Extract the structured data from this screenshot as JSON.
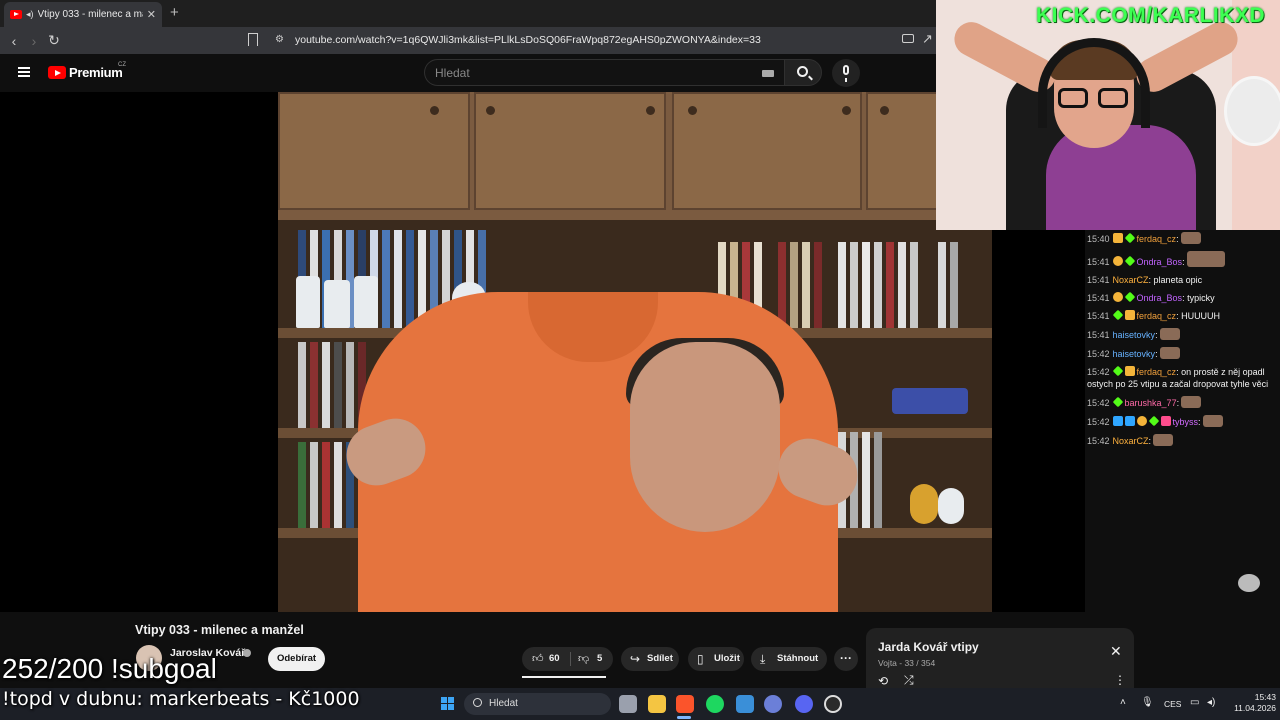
{
  "browser": {
    "tab_title": "Vtipy 033 - milenec a manžel",
    "tab_close": "✕",
    "new_tab": "+",
    "url": "youtube.com/watch?v=1q6QWJli3mk&list=PLlkLsDoSQ06FraWpq872egAHS0pZWONYA&index=33"
  },
  "youtube": {
    "logo_text": "Premium",
    "region": "CZ",
    "search_placeholder": "Hledat"
  },
  "stream": {
    "kick_url": "KICK.COM/KARLIKXD",
    "subgoal": "252/200 !subgoal",
    "top_donation": "!topd v dubnu: markerbeats - Kč1000"
  },
  "chat": [
    {
      "time": "15:40",
      "user": "ferdaq_cz",
      "user_color": "#f0a03c",
      "badges": [
        "sub",
        "star"
      ],
      "text": ":",
      "emote": true
    },
    {
      "time": "15:41",
      "user": "Ondra_Bos",
      "user_color": "#c264ff",
      "badges": [
        "coin",
        "star"
      ],
      "text": ":",
      "emote": true,
      "big": true
    },
    {
      "time": "15:41",
      "user": "NoxarCZ",
      "user_color": "#ffb23e",
      "badges": [],
      "text": ": planeta opic",
      "emote": false
    },
    {
      "time": "15:41",
      "user": "Ondra_Bos",
      "user_color": "#c264ff",
      "badges": [
        "coin",
        "star"
      ],
      "text": ": typicky",
      "emote": false
    },
    {
      "time": "15:41",
      "user": "ferdaq_cz",
      "user_color": "#f0a03c",
      "badges": [
        "star",
        "sub"
      ],
      "text": ": HUUUUH",
      "emote": false
    },
    {
      "time": "15:41",
      "user": "haisetovky",
      "user_color": "#67b2ff",
      "badges": [],
      "text": ":",
      "emote": true
    },
    {
      "time": "15:42",
      "user": "haisetovky",
      "user_color": "#67b2ff",
      "badges": [],
      "text": ":",
      "emote": true
    },
    {
      "time": "15:42",
      "user": "ferdaq_cz",
      "user_color": "#f0a03c",
      "badges": [
        "star",
        "sub"
      ],
      "text": ": on prostě z něj opadl ostych po 25 vtipu a začal dropovat tyhle věci",
      "emote": false
    },
    {
      "time": "15:42",
      "user": "barushka_77",
      "user_color": "#ff6aa8",
      "badges": [
        "star"
      ],
      "text": ":",
      "emote": true
    },
    {
      "time": "15:42",
      "user": "tybyss",
      "user_color": "#d36bff",
      "badges": [
        "blue",
        "blue",
        "coin",
        "star",
        "pink"
      ],
      "text": ":",
      "emote": true
    },
    {
      "time": "15:42",
      "user": "NoxarCZ",
      "user_color": "#ffb23e",
      "badges": [],
      "text": ":",
      "emote": true
    }
  ],
  "video": {
    "title": "Vtipy 033 - milenec a manžel",
    "channel": "Jaroslav Kovář",
    "subscribe_label": "Odebírat",
    "likes": "60",
    "dislikes": "5",
    "share_label": "Sdílet",
    "save_label": "Uložit",
    "download_label": "Stáhnout"
  },
  "playlist": {
    "title": "Jarda Kovář vtipy",
    "subtitle": "Vojta - 33 / 354"
  },
  "taskbar": {
    "search_placeholder": "Hledat",
    "lang": "CES",
    "time": "15:43",
    "date": "11.04.2026"
  },
  "colors": {
    "kick_green": "#53fc18",
    "youtube_red": "#ff0000",
    "shirt_orange": "#e5743e"
  }
}
